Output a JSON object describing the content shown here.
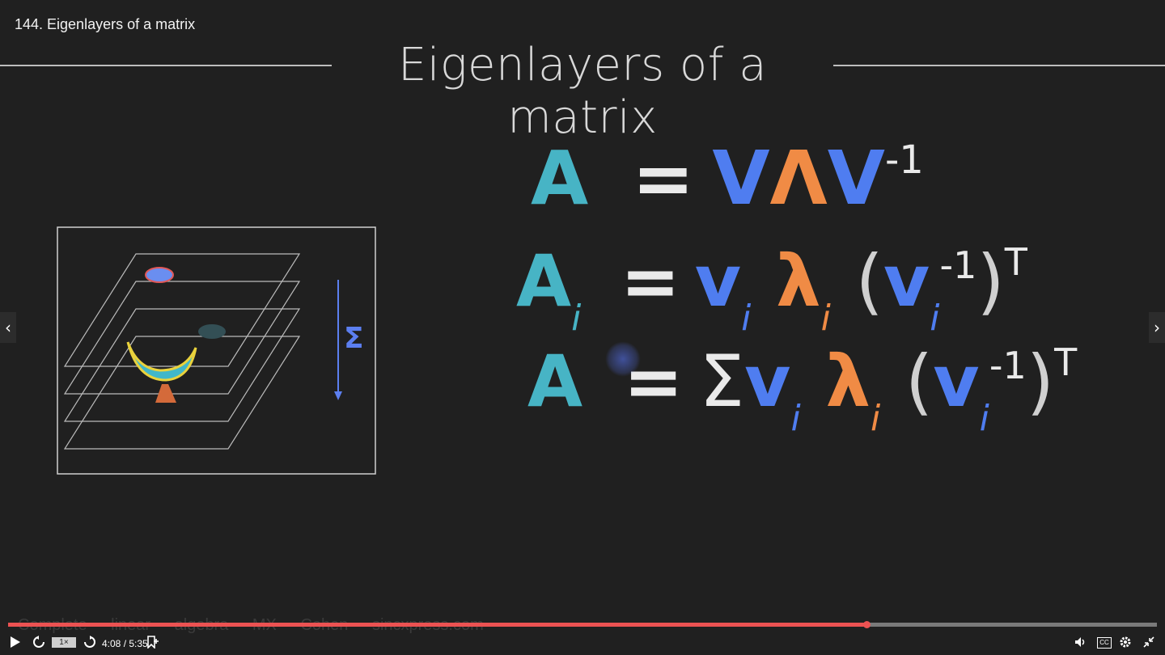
{
  "lesson": {
    "title": "144. Eigenlayers of a matrix"
  },
  "slide": {
    "title": "Eigenlayers of a matrix",
    "sigma_label": "Σ",
    "equations": {
      "eq1": {
        "lhs": "A",
        "eq": "=",
        "v1": "V",
        "lam": "Λ",
        "v2": "V",
        "sup": "-1"
      },
      "eq2": {
        "lhs": "A",
        "lhs_sub": "i",
        "eq": "=",
        "v": "v",
        "v_sub": "i",
        "lam": "λ",
        "lam_sub": "i",
        "lparen": "(",
        "v2": "v",
        "v2_sub": "i",
        "inv": "-1",
        "rparen": ")",
        "T": "T"
      },
      "eq3": {
        "lhs": "A",
        "eq": "=",
        "sum": "Σ",
        "v": "v",
        "v_sub": "i",
        "lam": "λ",
        "lam_sub": "i",
        "lparen": "(",
        "v2": "v",
        "v2_sub": "i",
        "inv": "-1",
        "rparen": ")",
        "T": "T"
      }
    },
    "footer": "Complete linear algebra   MX Cohen   sincxpress.com"
  },
  "nav": {
    "prev": "‹",
    "next": "›"
  },
  "player": {
    "progress_fraction": 0.747,
    "speed": "1×",
    "time": "4:08 / 5:35",
    "cc": "CC",
    "icons": [
      "play-icon",
      "rewind-icon",
      "forward-icon",
      "bookmark-add-icon",
      "volume-icon",
      "settings-icon",
      "fullscreen-exit-icon"
    ]
  },
  "colors": {
    "teal": "#47b4c5",
    "blue": "#4f7df0",
    "orange": "#f08b45",
    "progress": "#ec5252"
  }
}
